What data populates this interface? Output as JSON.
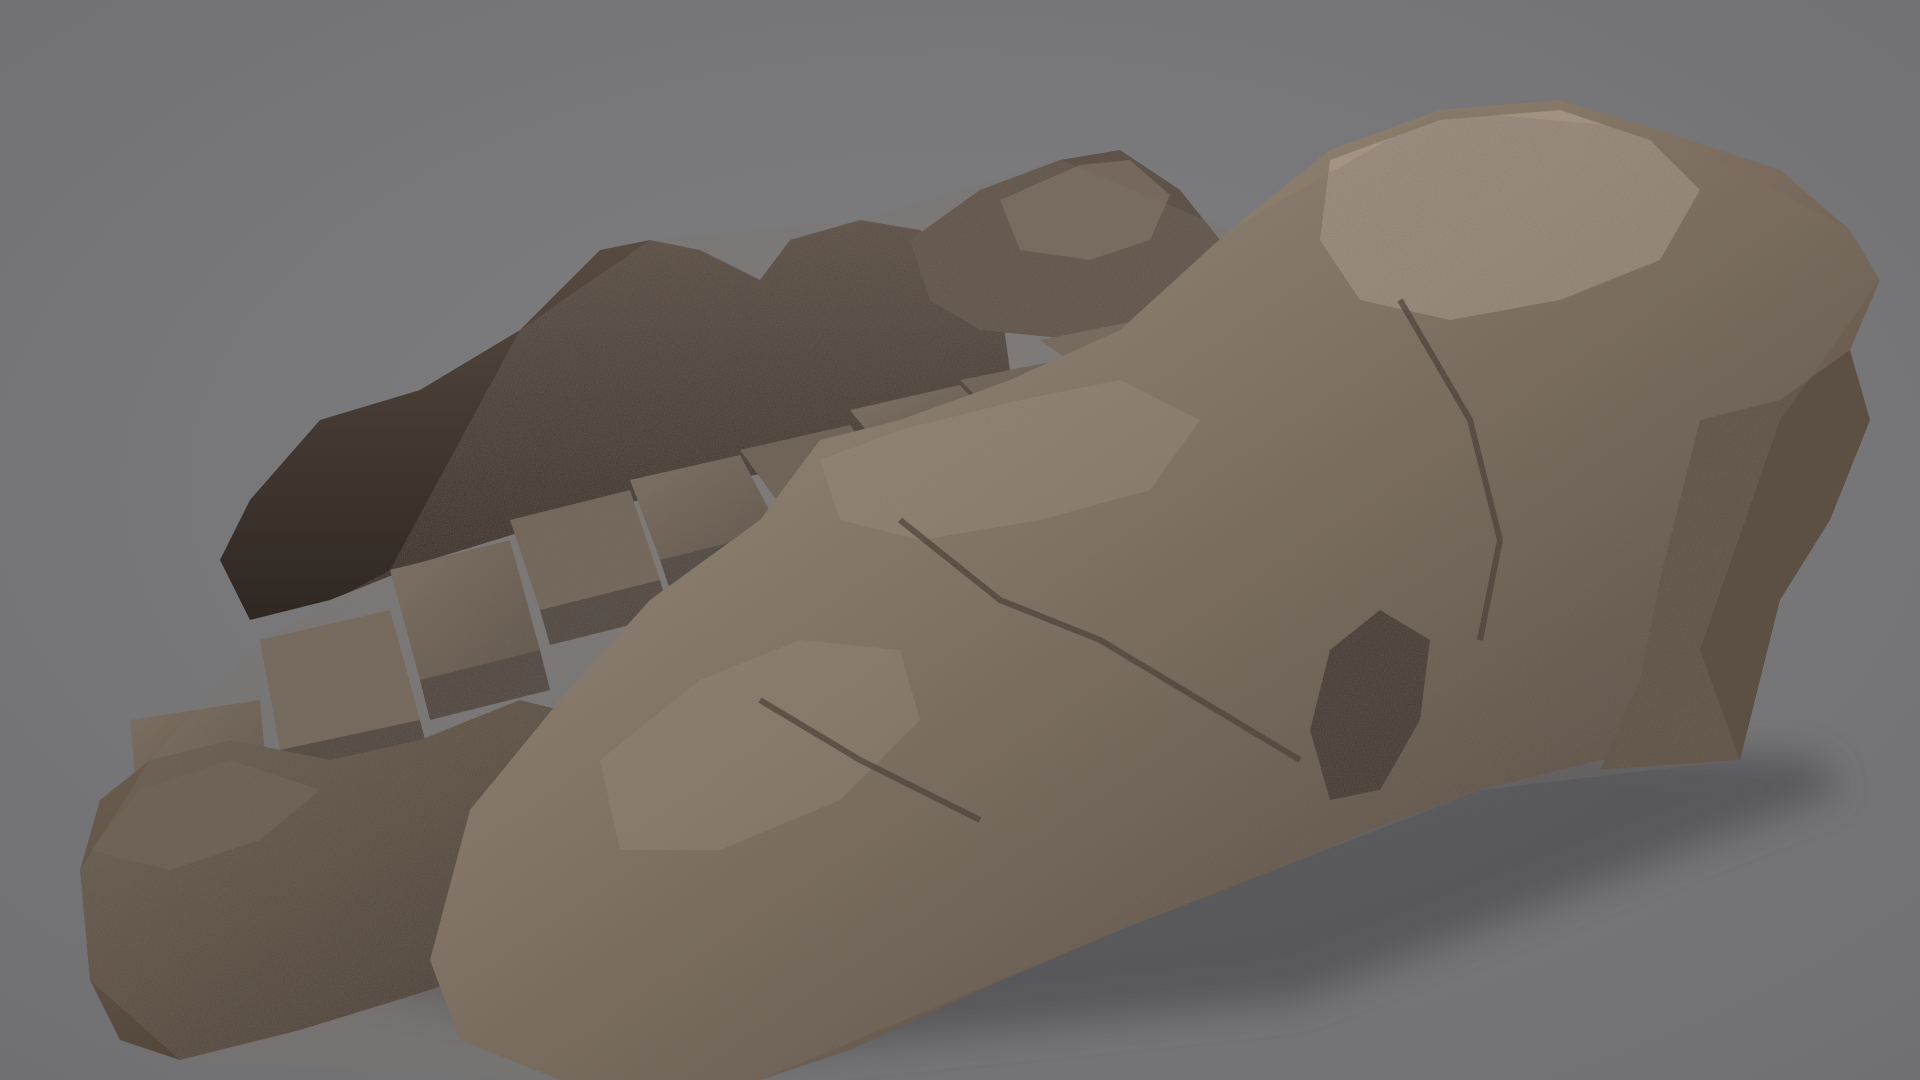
{
  "scene": {
    "subject": "rock-formation-with-stone-steps",
    "colors": {
      "background": "#7a7a7c",
      "shadow": "#5e5e60",
      "rock_dark": "#3b312a",
      "rock_mid": "#5d5046",
      "rock_light": "#8a7b6c",
      "rock_highlight": "#b2a494",
      "step_top": "#6e6155"
    }
  }
}
